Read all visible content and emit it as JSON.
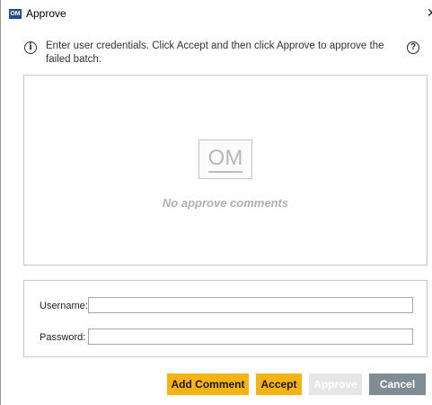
{
  "window": {
    "app_icon": "OM",
    "title": "Approve",
    "close_glyph": "✕"
  },
  "instruction": {
    "text": "Enter user credentials. Click Accept and then click Approve to approve the failed batch.",
    "info_icon": "info-circle-icon",
    "help_icon": "help-circle-icon"
  },
  "comments": {
    "logo_text": "OM",
    "empty_text": "No approve comments"
  },
  "credentials": {
    "username_label": "Username:",
    "username_value": "",
    "password_label": "Password:",
    "password_value": ""
  },
  "buttons": {
    "add_comment": "Add Comment",
    "accept": "Accept",
    "approve": "Approve",
    "cancel": "Cancel"
  },
  "colors": {
    "primary_button": "#f5b316",
    "cancel_button": "#7f8c92",
    "disabled_button": "#e6e6e6",
    "app_icon_bg": "#1e4d8c"
  }
}
